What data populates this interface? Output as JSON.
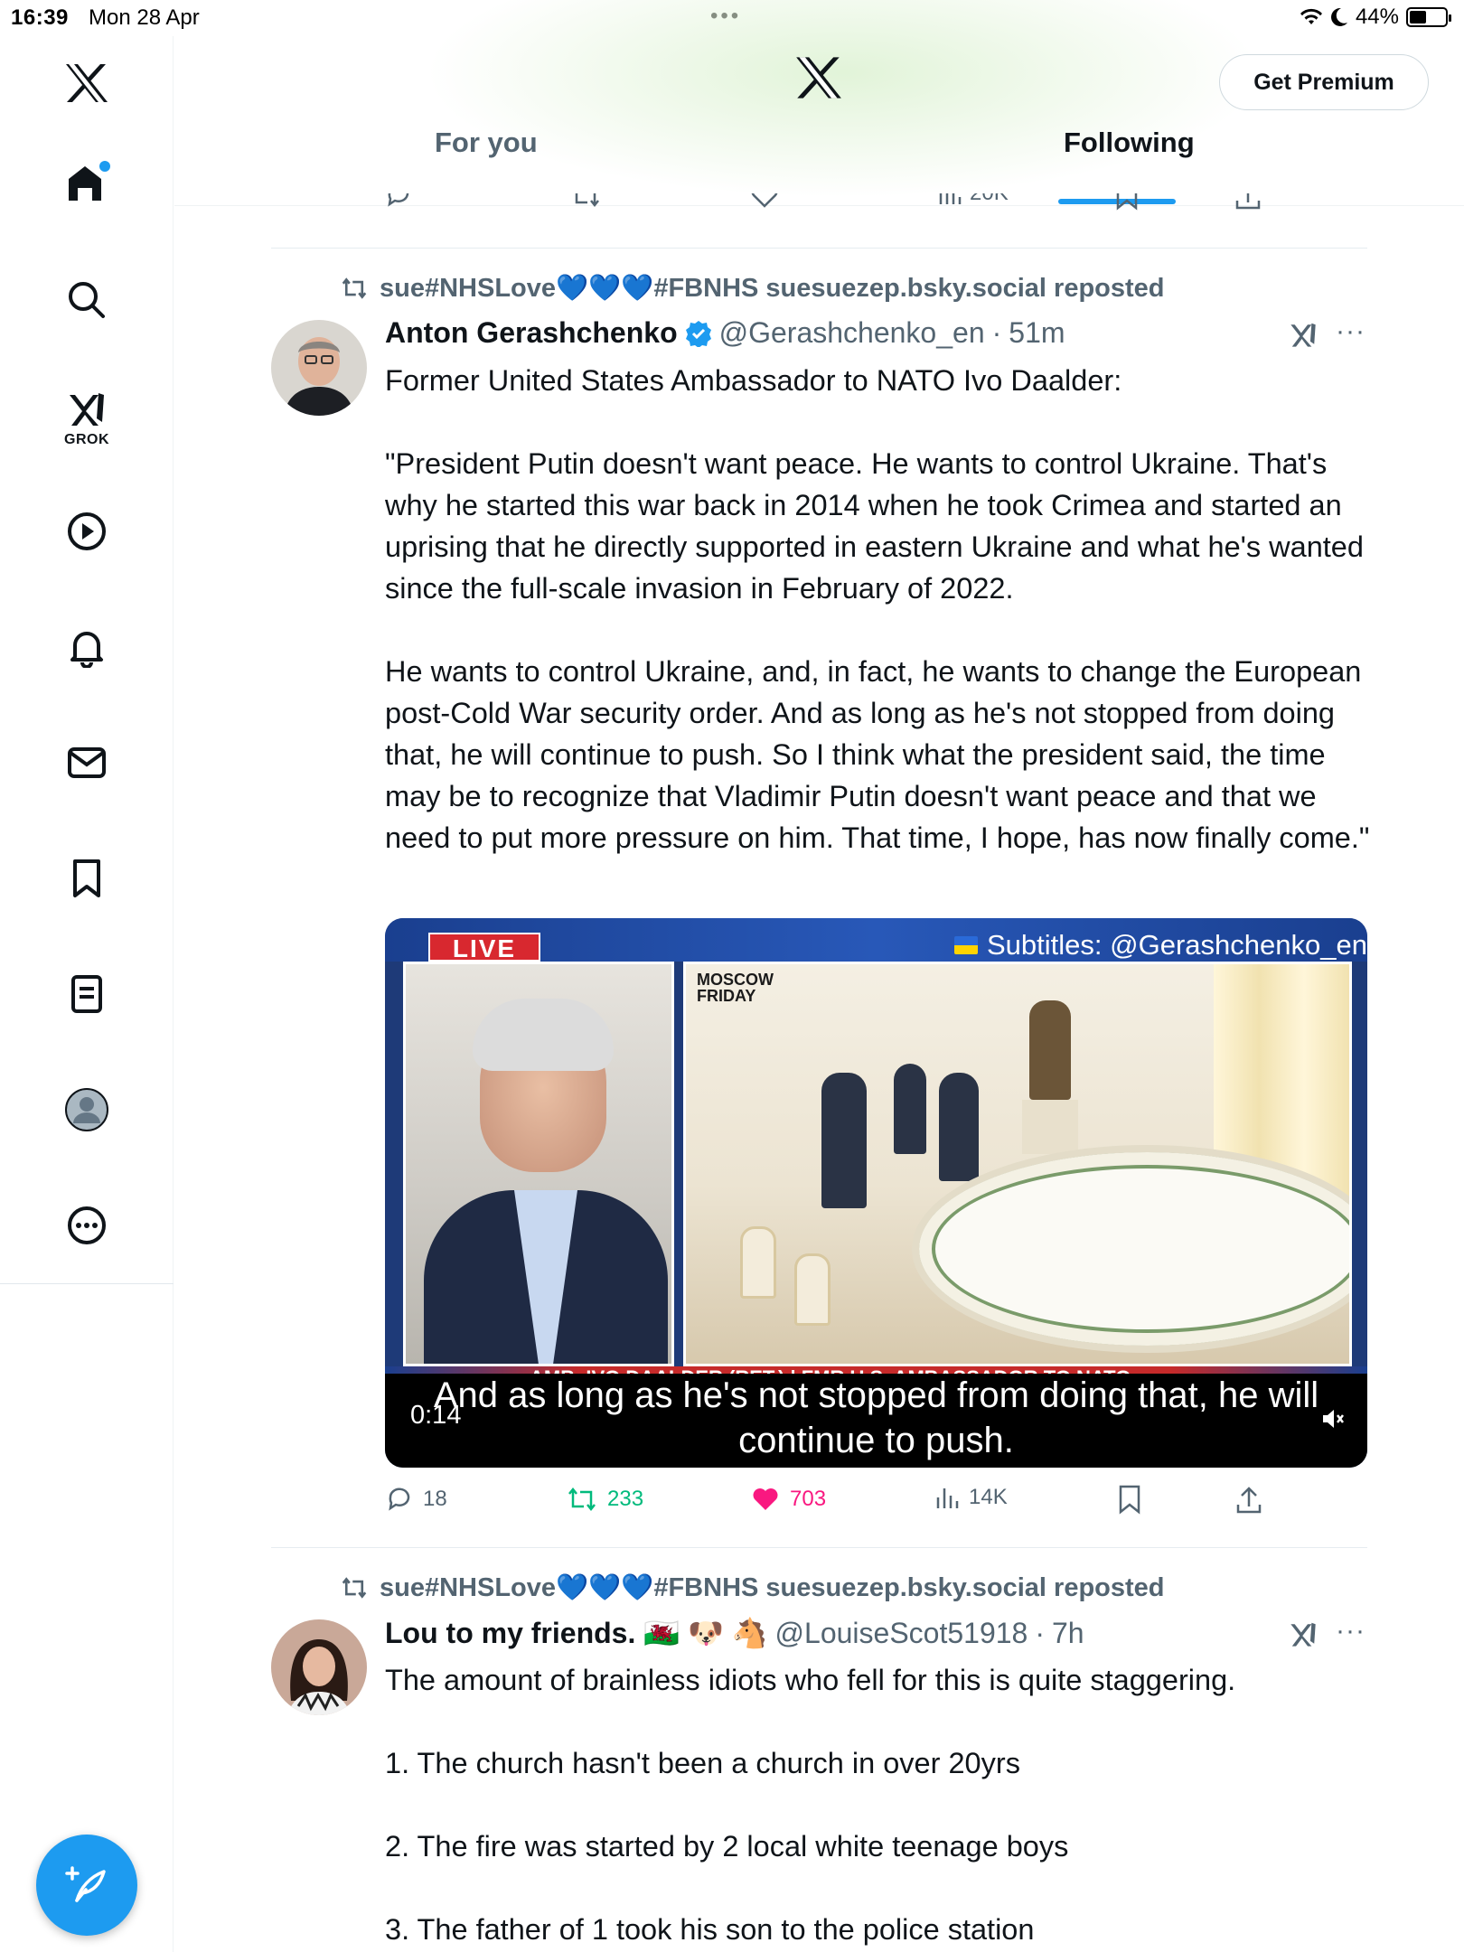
{
  "status_bar": {
    "time": "16:39",
    "date": "Mon 28 Apr",
    "battery": "44%",
    "battery_level": 0.44
  },
  "sidebar": {
    "items": [
      {
        "icon": "x-logo-icon"
      },
      {
        "icon": "home-icon",
        "has_notification_dot": true
      },
      {
        "icon": "search-icon"
      },
      {
        "icon": "grok-icon",
        "label": "GROK"
      },
      {
        "icon": "video-icon"
      },
      {
        "icon": "bell-icon"
      },
      {
        "icon": "mail-icon"
      },
      {
        "icon": "bookmark-icon"
      },
      {
        "icon": "lists-icon"
      },
      {
        "icon": "profile-icon"
      },
      {
        "icon": "more-icon"
      }
    ],
    "compose_icon": "compose-icon"
  },
  "header": {
    "premium_button": "Get Premium",
    "tabs": [
      {
        "label": "For you",
        "active": false
      },
      {
        "label": "Following",
        "active": true
      }
    ]
  },
  "previous_tweet": {
    "views": "20K"
  },
  "tweets": [
    {
      "repost_by": "sue#NHSLove💙💙💙#FBNHS suesuezep.bsky.social reposted",
      "name": "Anton Gerashchenko",
      "verified": true,
      "handle": "@Gerashchenko_en",
      "time": "51m",
      "paragraphs": [
        "Former United States Ambassador to NATO Ivo Daalder:",
        "\"President Putin doesn't want peace. He wants to control Ukraine. That's why he started this war back in 2014 when he took Crimea and started an uprising that he directly supported in eastern Ukraine and what he's wanted since the full-scale invasion in February of 2022.",
        "He wants to control Ukraine, and, in fact, he wants to change the European post-Cold War security order. And as long as he's not stopped from doing that, he will continue to push. So I think what the president said, the time may be to recognize that Vladimir Putin doesn't want peace and that we need to put more pressure on him. That time, I hope, has now finally come.\""
      ],
      "video": {
        "live_badge": "LIVE",
        "subtitles_credit": "Subtitles: @Gerashchenko_en",
        "location_tag": [
          "MOSCOW",
          "FRIDAY"
        ],
        "lower_third": "AMB. IVO DAALDER (RET.) | FMR U.S. AMBASSADOR TO NATO",
        "caption_line1": "And as long as he's not stopped from doing that, he will",
        "caption_line2": "continue to push.",
        "timestamp": "0:14"
      },
      "stats": {
        "replies": "18",
        "reposts": "233",
        "likes": "703",
        "views": "14K"
      }
    },
    {
      "repost_by": "sue#NHSLove💙💙💙#FBNHS suesuezep.bsky.social reposted",
      "name": "Lou to my friends. 🏴󠁧󠁢󠁷󠁬󠁳󠁿 🐶 🐴",
      "handle": "@LouiseScot51918",
      "time": "7h",
      "paragraphs": [
        "The amount of brainless idiots who fell for this is quite staggering.",
        "1. The church hasn't been a church in over 20yrs",
        "2. The fire was started by 2 local white teenage boys",
        "3. The father of 1 took his son to the police station"
      ]
    }
  ]
}
